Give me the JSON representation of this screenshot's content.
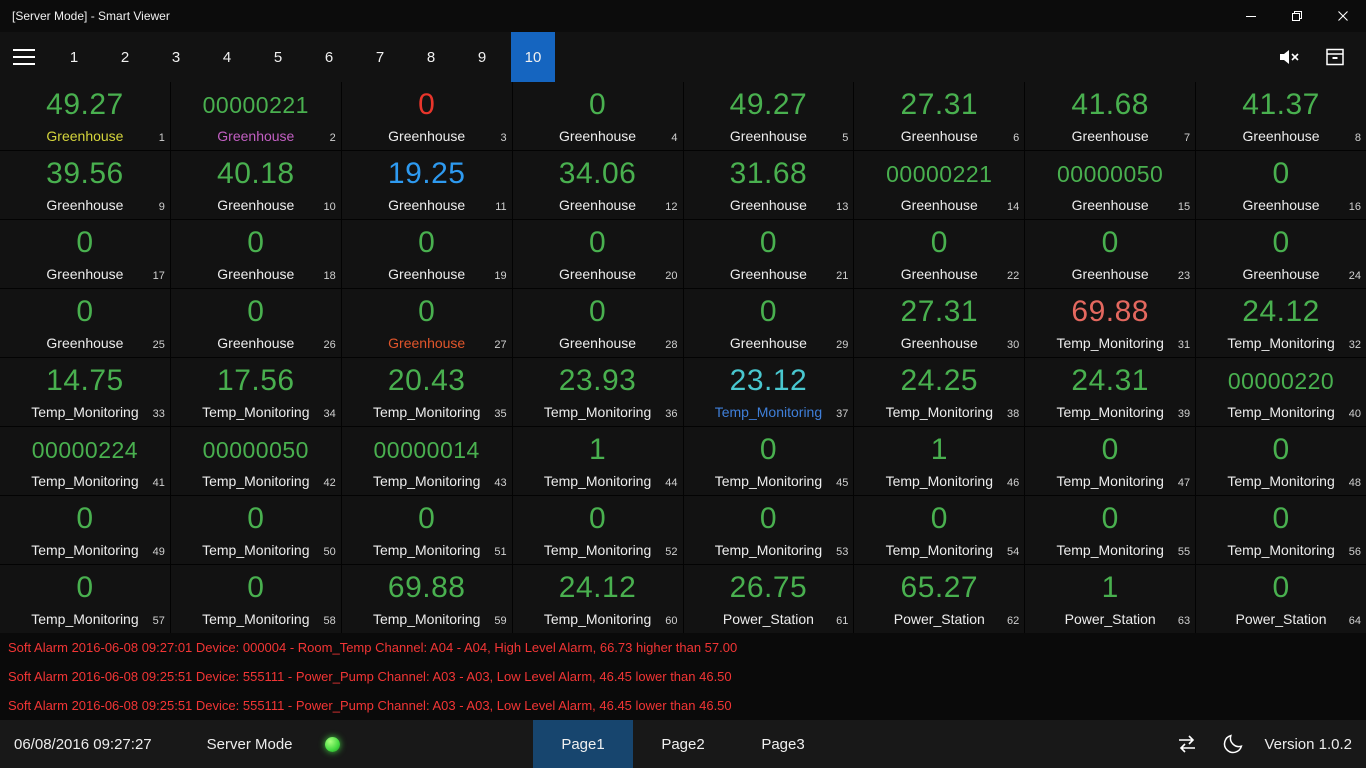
{
  "window": {
    "title": "[Server Mode] - Smart Viewer"
  },
  "nav": {
    "pages": [
      "1",
      "2",
      "3",
      "4",
      "5",
      "6",
      "7",
      "8",
      "9",
      "10"
    ],
    "selected": "10"
  },
  "colors": {
    "green": "#49b04f",
    "red": "#e8352b",
    "salmon": "#e4685f",
    "blue": "#2e9af0",
    "teal": "#49c7cf",
    "label": "#ededed",
    "yellow": "#d4d43c",
    "magenta": "#c25fc2",
    "orange": "#e0552b",
    "label_blue": "#3f7fd9",
    "alarm": "#f23535",
    "accent": "#1565c0",
    "tab_active": "#17456e",
    "status_ok": "#43d940"
  },
  "tiles": [
    {
      "v": "49.27",
      "l": "Greenhouse",
      "n": "1",
      "lc": "yellow"
    },
    {
      "v": "00000221",
      "l": "Greenhouse",
      "n": "2",
      "lc": "magenta"
    },
    {
      "v": "0",
      "l": "Greenhouse",
      "n": "3",
      "vc": "red"
    },
    {
      "v": "0",
      "l": "Greenhouse",
      "n": "4"
    },
    {
      "v": "49.27",
      "l": "Greenhouse",
      "n": "5"
    },
    {
      "v": "27.31",
      "l": "Greenhouse",
      "n": "6"
    },
    {
      "v": "41.68",
      "l": "Greenhouse",
      "n": "7"
    },
    {
      "v": "41.37",
      "l": "Greenhouse",
      "n": "8"
    },
    {
      "v": "39.56",
      "l": "Greenhouse",
      "n": "9"
    },
    {
      "v": "40.18",
      "l": "Greenhouse",
      "n": "10"
    },
    {
      "v": "19.25",
      "l": "Greenhouse",
      "n": "11",
      "vc": "blue"
    },
    {
      "v": "34.06",
      "l": "Greenhouse",
      "n": "12"
    },
    {
      "v": "31.68",
      "l": "Greenhouse",
      "n": "13"
    },
    {
      "v": "00000221",
      "l": "Greenhouse",
      "n": "14"
    },
    {
      "v": "00000050",
      "l": "Greenhouse",
      "n": "15"
    },
    {
      "v": "0",
      "l": "Greenhouse",
      "n": "16"
    },
    {
      "v": "0",
      "l": "Greenhouse",
      "n": "17"
    },
    {
      "v": "0",
      "l": "Greenhouse",
      "n": "18"
    },
    {
      "v": "0",
      "l": "Greenhouse",
      "n": "19"
    },
    {
      "v": "0",
      "l": "Greenhouse",
      "n": "20"
    },
    {
      "v": "0",
      "l": "Greenhouse",
      "n": "21"
    },
    {
      "v": "0",
      "l": "Greenhouse",
      "n": "22"
    },
    {
      "v": "0",
      "l": "Greenhouse",
      "n": "23"
    },
    {
      "v": "0",
      "l": "Greenhouse",
      "n": "24"
    },
    {
      "v": "0",
      "l": "Greenhouse",
      "n": "25"
    },
    {
      "v": "0",
      "l": "Greenhouse",
      "n": "26"
    },
    {
      "v": "0",
      "l": "Greenhouse",
      "n": "27",
      "lc": "orange"
    },
    {
      "v": "0",
      "l": "Greenhouse",
      "n": "28"
    },
    {
      "v": "0",
      "l": "Greenhouse",
      "n": "29"
    },
    {
      "v": "27.31",
      "l": "Greenhouse",
      "n": "30"
    },
    {
      "v": "69.88",
      "l": "Temp_Monitoring",
      "n": "31",
      "vc": "salmon"
    },
    {
      "v": "24.12",
      "l": "Temp_Monitoring",
      "n": "32"
    },
    {
      "v": "14.75",
      "l": "Temp_Monitoring",
      "n": "33"
    },
    {
      "v": "17.56",
      "l": "Temp_Monitoring",
      "n": "34"
    },
    {
      "v": "20.43",
      "l": "Temp_Monitoring",
      "n": "35"
    },
    {
      "v": "23.93",
      "l": "Temp_Monitoring",
      "n": "36"
    },
    {
      "v": "23.12",
      "l": "Temp_Monitoring",
      "n": "37",
      "vc": "teal",
      "lc": "label_blue"
    },
    {
      "v": "24.25",
      "l": "Temp_Monitoring",
      "n": "38"
    },
    {
      "v": "24.31",
      "l": "Temp_Monitoring",
      "n": "39"
    },
    {
      "v": "00000220",
      "l": "Temp_Monitoring",
      "n": "40"
    },
    {
      "v": "00000224",
      "l": "Temp_Monitoring",
      "n": "41"
    },
    {
      "v": "00000050",
      "l": "Temp_Monitoring",
      "n": "42"
    },
    {
      "v": "00000014",
      "l": "Temp_Monitoring",
      "n": "43"
    },
    {
      "v": "1",
      "l": "Temp_Monitoring",
      "n": "44"
    },
    {
      "v": "0",
      "l": "Temp_Monitoring",
      "n": "45"
    },
    {
      "v": "1",
      "l": "Temp_Monitoring",
      "n": "46"
    },
    {
      "v": "0",
      "l": "Temp_Monitoring",
      "n": "47"
    },
    {
      "v": "0",
      "l": "Temp_Monitoring",
      "n": "48"
    },
    {
      "v": "0",
      "l": "Temp_Monitoring",
      "n": "49"
    },
    {
      "v": "0",
      "l": "Temp_Monitoring",
      "n": "50"
    },
    {
      "v": "0",
      "l": "Temp_Monitoring",
      "n": "51"
    },
    {
      "v": "0",
      "l": "Temp_Monitoring",
      "n": "52"
    },
    {
      "v": "0",
      "l": "Temp_Monitoring",
      "n": "53"
    },
    {
      "v": "0",
      "l": "Temp_Monitoring",
      "n": "54"
    },
    {
      "v": "0",
      "l": "Temp_Monitoring",
      "n": "55"
    },
    {
      "v": "0",
      "l": "Temp_Monitoring",
      "n": "56"
    },
    {
      "v": "0",
      "l": "Temp_Monitoring",
      "n": "57"
    },
    {
      "v": "0",
      "l": "Temp_Monitoring",
      "n": "58"
    },
    {
      "v": "69.88",
      "l": "Temp_Monitoring",
      "n": "59"
    },
    {
      "v": "24.12",
      "l": "Temp_Monitoring",
      "n": "60"
    },
    {
      "v": "26.75",
      "l": "Power_Station",
      "n": "61"
    },
    {
      "v": "65.27",
      "l": "Power_Station",
      "n": "62"
    },
    {
      "v": "1",
      "l": "Power_Station",
      "n": "63"
    },
    {
      "v": "0",
      "l": "Power_Station",
      "n": "64"
    }
  ],
  "alarms": [
    "Soft Alarm 2016-06-08 09:27:01 Device: 000004 - Room_Temp Channel: A04 - A04, High Level Alarm, 66.73 higher than 57.00",
    "Soft Alarm 2016-06-08 09:25:51 Device: 555111 - Power_Pump Channel: A03 - A03, Low Level Alarm, 46.45 lower than 46.50",
    "Soft Alarm 2016-06-08 09:25:51 Device: 555111 - Power_Pump Channel: A03 - A03, Low Level Alarm, 46.45 lower than 46.50"
  ],
  "statusbar": {
    "datetime": "06/08/2016 09:27:27",
    "mode": "Server Mode",
    "tabs": [
      "Page1",
      "Page2",
      "Page3"
    ],
    "selected_tab": "Page1",
    "version": "Version 1.0.2"
  }
}
